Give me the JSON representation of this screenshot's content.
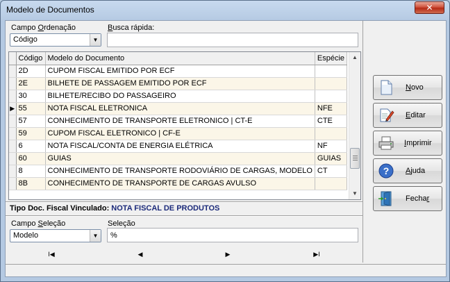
{
  "window": {
    "title": "Modelo de Documentos",
    "close_label": "✕"
  },
  "ordenacao": {
    "label_pre": "Campo ",
    "label_u": "O",
    "label_post": "rdenação",
    "value": "Código"
  },
  "busca": {
    "label_pre": "",
    "label_u": "B",
    "label_post": "usca rápida:",
    "value": ""
  },
  "grid": {
    "headers": {
      "codigo": "Código",
      "modelo": "Modelo do Documento",
      "especie": "Espécie"
    },
    "current_marker": "▶",
    "rows": [
      {
        "codigo": "2D",
        "modelo": "CUPOM FISCAL EMITIDO POR ECF",
        "especie": ""
      },
      {
        "codigo": "2E",
        "modelo": "BILHETE DE PASSAGEM EMITIDO POR ECF",
        "especie": ""
      },
      {
        "codigo": "30",
        "modelo": "BILHETE/RECIBO DO PASSAGEIRO",
        "especie": ""
      },
      {
        "codigo": "55",
        "modelo": "NOTA FISCAL ELETRONICA",
        "especie": "NFE"
      },
      {
        "codigo": "57",
        "modelo": "CONHECIMENTO DE TRANSPORTE ELETRONICO | CT-E",
        "especie": "CTE"
      },
      {
        "codigo": "59",
        "modelo": "CUPOM FISCAL ELETRONICO | CF-E",
        "especie": ""
      },
      {
        "codigo": "6",
        "modelo": "NOTA FISCAL/CONTA DE ENERGIA ELÉTRICA",
        "especie": "NF"
      },
      {
        "codigo": "60",
        "modelo": "GUIAS",
        "especie": "GUIAS"
      },
      {
        "codigo": "8",
        "modelo": "CONHECIMENTO DE TRANSPORTE RODOVIÁRIO DE CARGAS, MODELO",
        "especie": "CT"
      },
      {
        "codigo": "8B",
        "modelo": "CONHECIMENTO DE TRANSPORTE DE CARGAS AVULSO",
        "especie": ""
      }
    ]
  },
  "tipo_doc": {
    "label": "Tipo Doc. Fiscal Vinculado: ",
    "value": "NOTA FISCAL DE PRODUTOS"
  },
  "selecao_campo": {
    "label_pre": "Campo ",
    "label_u": "S",
    "label_post": "eleção",
    "value": "Modelo"
  },
  "selecao": {
    "label": "Seleção",
    "value": "%"
  },
  "nav": {
    "first": "I◀",
    "prev": "◀",
    "next": "▶",
    "last": "▶I"
  },
  "buttons": {
    "novo": {
      "pre": "",
      "u": "N",
      "post": "ovo"
    },
    "editar": {
      "pre": "",
      "u": "E",
      "post": "ditar"
    },
    "imprimir": {
      "pre": "",
      "u": "I",
      "post": "mprimir"
    },
    "ajuda": {
      "pre": "",
      "u": "A",
      "post": "juda"
    },
    "fechar": {
      "pre": "Fecha",
      "u": "r",
      "post": ""
    }
  }
}
